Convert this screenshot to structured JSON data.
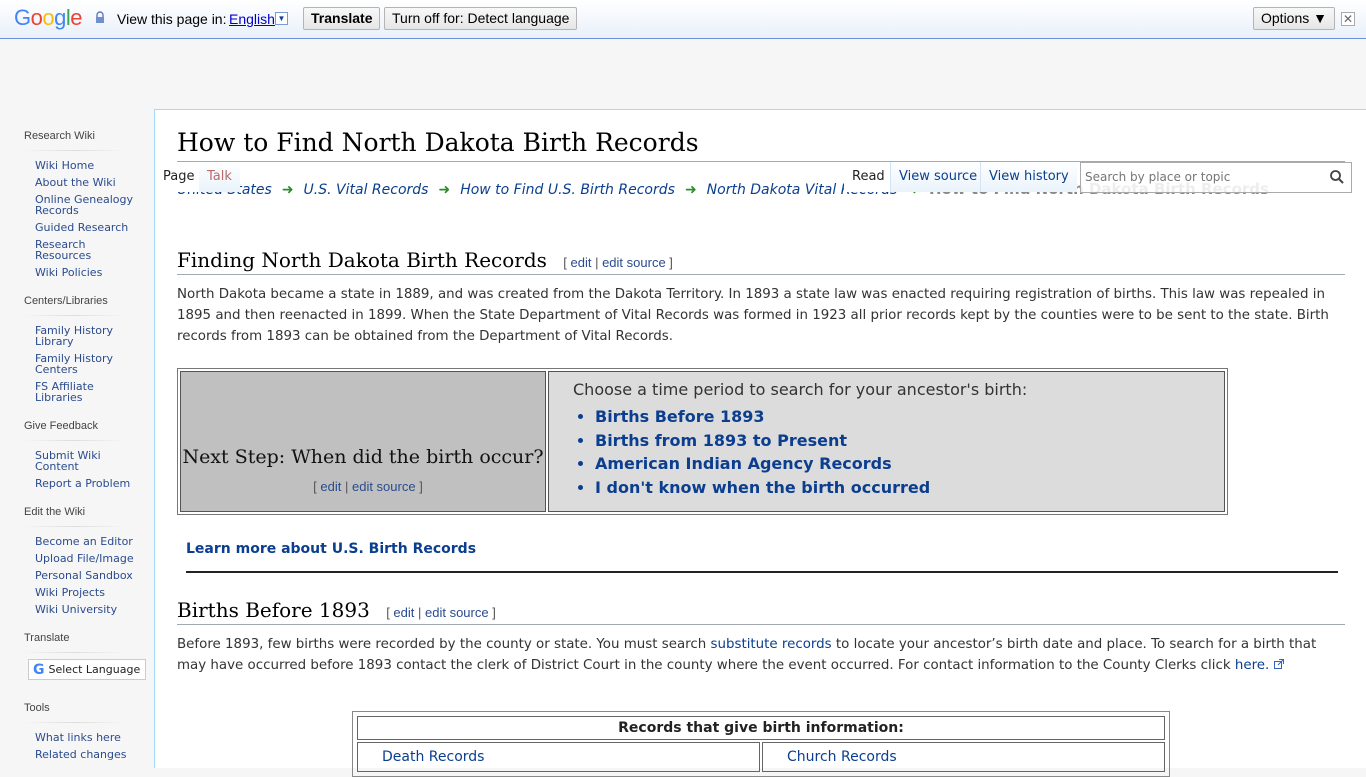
{
  "translate_bar": {
    "logo_letters": [
      "G",
      "o",
      "o",
      "g",
      "l",
      "e"
    ],
    "logo_colors": [
      "#4285f4",
      "#ea4335",
      "#fbbc05",
      "#4285f4",
      "#34a853",
      "#ea4335"
    ],
    "view_in_label": "View this page in:",
    "language": "English",
    "translate_label": "Translate",
    "turn_off_label": "Turn off for: Detect language",
    "options_label": "Options ▼",
    "close_glyph": "✕"
  },
  "sidebar": {
    "sections": [
      {
        "heading": "Research Wiki",
        "items": [
          "Wiki Home",
          "About the Wiki",
          "Online Genealogy Records",
          "Guided Research",
          "Research Resources",
          "Wiki Policies"
        ]
      },
      {
        "heading": "Centers/Libraries",
        "items": [
          "Family History Library",
          "Family History Centers",
          "FS Affiliate Libraries"
        ]
      },
      {
        "heading": "Give Feedback",
        "items": [
          "Submit Wiki Content",
          "Report a Problem"
        ]
      },
      {
        "heading": "Edit the Wiki",
        "items": [
          "Become an Editor",
          "Upload File/Image",
          "Personal Sandbox",
          "Wiki Projects",
          "Wiki University"
        ]
      }
    ],
    "translate": {
      "heading": "Translate",
      "select_label": "Select Language"
    },
    "tools": {
      "heading": "Tools",
      "items": [
        "What links here",
        "Related changes"
      ]
    }
  },
  "tabs": {
    "page": "Page",
    "talk": "Talk",
    "read": "Read",
    "view_source": "View source",
    "view_history": "View history"
  },
  "search": {
    "placeholder": "Search by place or topic"
  },
  "page": {
    "title": "How to Find North Dakota Birth Records",
    "breadcrumb": [
      "United States",
      "U.S. Vital Records",
      "How to Find U.S. Birth Records",
      "North Dakota Vital Records"
    ],
    "breadcrumb_current": "How to Find North Dakota Birth Records",
    "edit_label": "edit",
    "edit_source_label": "edit source",
    "section1": {
      "heading": "Finding North Dakota Birth Records",
      "text": "North Dakota became a state in 1889, and was created from the Dakota Territory. In 1893 a state law was enacted requiring registration of births. This law was repealed in 1895 and then reenacted in 1899. When the State Department of Vital Records was formed in 1923 all prior records kept by the counties were to be sent to the state. Birth records from 1893 can be obtained from the Department of Vital Records."
    },
    "next_step": {
      "heading": "Next Step: When did the birth occur?",
      "prompt": "Choose a time period to search for your ancestor's birth:",
      "links": [
        "Births Before 1893",
        "Births from 1893 to Present",
        "American Indian Agency Records",
        "I don't know when the birth occurred"
      ]
    },
    "learn_more": "Learn more about U.S. Birth Records",
    "section2": {
      "heading": "Births Before 1893",
      "text_before": "Before 1893, few births were recorded by the county or state. You must search ",
      "link1": "substitute records",
      "text_middle": " to locate your ancestor’s birth date and place. To search for a birth that may have occurred before 1893 contact the clerk of District Court in the county where the event occurred. For contact information to the County Clerks click ",
      "link2": "here."
    },
    "records_table": {
      "header": "Records that give birth information:",
      "rows": [
        [
          "Death Records",
          "Church Records"
        ]
      ]
    }
  }
}
